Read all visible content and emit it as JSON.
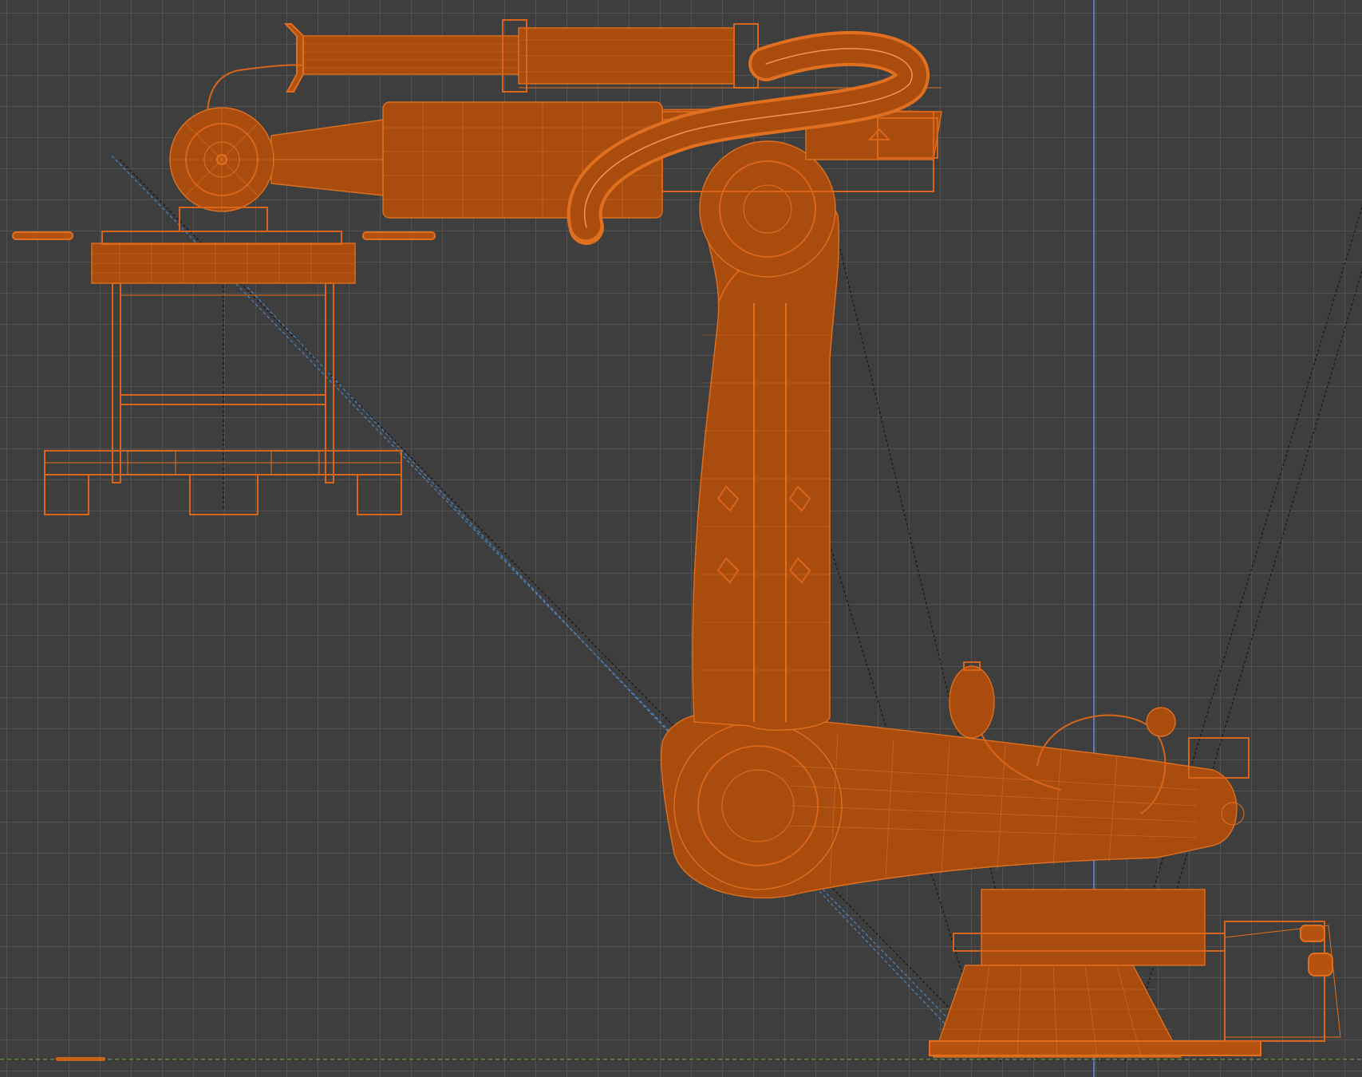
{
  "viewport": {
    "view": "3d-wireframe-orthographic",
    "colors": {
      "background": "#3e3e3e",
      "grid": "#565656",
      "wireframe_selected": "#e0701f",
      "guide_dark": "#151515",
      "guide_blue": "#4a86c2",
      "z_axis": "#6a8fd8",
      "ground_axis": "#6aa84f"
    },
    "objects": [
      "robot-arm",
      "pallet-stand",
      "gripper-tool"
    ]
  }
}
